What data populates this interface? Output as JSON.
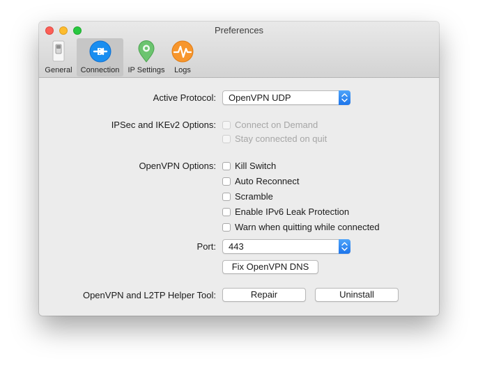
{
  "window": {
    "title": "Preferences"
  },
  "toolbar": {
    "items": [
      {
        "label": "General",
        "icon": "switch-icon",
        "selected": false
      },
      {
        "label": "Connection",
        "icon": "plug-icon",
        "selected": true
      },
      {
        "label": "IP Settings",
        "icon": "location-pin-icon",
        "selected": false
      },
      {
        "label": "Logs",
        "icon": "pulse-icon",
        "selected": false
      }
    ]
  },
  "connection": {
    "active_protocol": {
      "label": "Active Protocol:",
      "value": "OpenVPN UDP"
    },
    "ipsec": {
      "label": "IPSec and IKEv2 Options:",
      "options": [
        {
          "label": "Connect on Demand",
          "checked": false,
          "enabled": false
        },
        {
          "label": "Stay connected on quit",
          "checked": false,
          "enabled": false
        }
      ]
    },
    "openvpn": {
      "label": "OpenVPN Options:",
      "options": [
        {
          "label": "Kill Switch",
          "checked": false,
          "enabled": true
        },
        {
          "label": "Auto Reconnect",
          "checked": false,
          "enabled": true
        },
        {
          "label": "Scramble",
          "checked": false,
          "enabled": true
        },
        {
          "label": "Enable IPv6 Leak Protection",
          "checked": false,
          "enabled": true
        },
        {
          "label": "Warn when quitting while connected",
          "checked": false,
          "enabled": true
        }
      ]
    },
    "port": {
      "label": "Port:",
      "value": "443"
    },
    "fix_dns_button": "Fix OpenVPN DNS",
    "helper_tool": {
      "label": "OpenVPN and L2TP Helper Tool:",
      "repair_button": "Repair",
      "uninstall_button": "Uninstall"
    }
  },
  "colors": {
    "accent": "#1d74ea",
    "selected_toolbar": "#c6c6c6"
  }
}
